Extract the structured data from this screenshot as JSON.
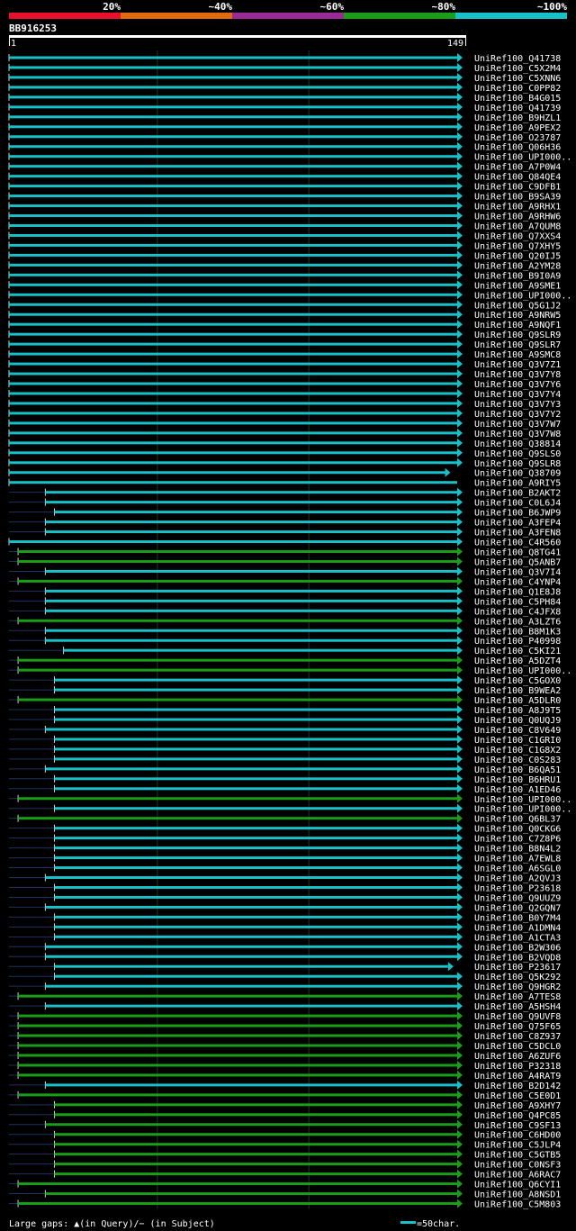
{
  "colors": {
    "background": "#000000",
    "grid": "#1c3a1c",
    "band_red": "#e8102a",
    "band_orange": "#e06a10",
    "band_purple": "#9a2a96",
    "band_green": "#1a9e1a",
    "band_cyan": "#18c0c8",
    "cyan_hit": "#18c0c8",
    "green_hit": "#1a9e1a",
    "gap": "#203060"
  },
  "legend": {
    "labels": [
      "20%",
      "~40%",
      "~60%",
      "~80%",
      "~100%"
    ]
  },
  "query": {
    "name": "BB916253",
    "start_label": "1",
    "end_label": "149"
  },
  "footer": {
    "gaps_text": "Large gaps: ▲(in Query)/− (in Subject)",
    "scale_text": "=50char."
  },
  "chart_data": {
    "type": "alignment",
    "query_length": 149,
    "grid_x": [
      50,
      100
    ],
    "hits": [
      {
        "name": "UniRef100_Q41738",
        "start": 1,
        "end": 149,
        "identity": "~100%",
        "arrow": true
      },
      {
        "name": "UniRef100_C5X2M4",
        "start": 1,
        "end": 149,
        "identity": "~100%",
        "arrow": true
      },
      {
        "name": "UniRef100_C5XNN6",
        "start": 1,
        "end": 149,
        "identity": "~100%",
        "arrow": true
      },
      {
        "name": "UniRef100_C0PP82",
        "start": 1,
        "end": 149,
        "identity": "~100%",
        "arrow": true
      },
      {
        "name": "UniRef100_B4G015",
        "start": 1,
        "end": 149,
        "identity": "~100%",
        "arrow": true
      },
      {
        "name": "UniRef100_Q41739",
        "start": 1,
        "end": 149,
        "identity": "~100%",
        "arrow": true
      },
      {
        "name": "UniRef100_B9HZL1",
        "start": 1,
        "end": 149,
        "identity": "~100%",
        "arrow": true
      },
      {
        "name": "UniRef100_A9PEX2",
        "start": 1,
        "end": 149,
        "identity": "~100%",
        "arrow": true
      },
      {
        "name": "UniRef100_O23787",
        "start": 1,
        "end": 149,
        "identity": "~100%",
        "arrow": true
      },
      {
        "name": "UniRef100_Q06H36",
        "start": 1,
        "end": 149,
        "identity": "~100%",
        "arrow": true
      },
      {
        "name": "UniRef100_UPI000..",
        "start": 1,
        "end": 149,
        "identity": "~100%",
        "arrow": true
      },
      {
        "name": "UniRef100_A7P0W4",
        "start": 1,
        "end": 149,
        "identity": "~100%",
        "arrow": true
      },
      {
        "name": "UniRef100_Q84QE4",
        "start": 1,
        "end": 149,
        "identity": "~100%",
        "arrow": true
      },
      {
        "name": "UniRef100_C9DFB1",
        "start": 1,
        "end": 149,
        "identity": "~100%",
        "arrow": true
      },
      {
        "name": "UniRef100_B9SA39",
        "start": 1,
        "end": 149,
        "identity": "~100%",
        "arrow": true
      },
      {
        "name": "UniRef100_A9RHX1",
        "start": 1,
        "end": 149,
        "identity": "~100%",
        "arrow": true
      },
      {
        "name": "UniRef100_A9RHW6",
        "start": 1,
        "end": 149,
        "identity": "~100%",
        "arrow": true
      },
      {
        "name": "UniRef100_A7QUM8",
        "start": 1,
        "end": 149,
        "identity": "~100%",
        "arrow": true
      },
      {
        "name": "UniRef100_Q7XXS4",
        "start": 1,
        "end": 149,
        "identity": "~100%",
        "arrow": true
      },
      {
        "name": "UniRef100_Q7XHY5",
        "start": 1,
        "end": 149,
        "identity": "~100%",
        "arrow": true
      },
      {
        "name": "UniRef100_Q20IJ5",
        "start": 1,
        "end": 149,
        "identity": "~100%",
        "arrow": true
      },
      {
        "name": "UniRef100_A2YM28",
        "start": 1,
        "end": 149,
        "identity": "~100%",
        "arrow": true
      },
      {
        "name": "UniRef100_B9I0A9",
        "start": 1,
        "end": 149,
        "identity": "~100%",
        "arrow": true
      },
      {
        "name": "UniRef100_A9SME1",
        "start": 1,
        "end": 149,
        "identity": "~100%",
        "arrow": true
      },
      {
        "name": "UniRef100_UPI000..",
        "start": 1,
        "end": 149,
        "identity": "~100%",
        "arrow": true
      },
      {
        "name": "UniRef100_Q5G1J2",
        "start": 1,
        "end": 149,
        "identity": "~100%",
        "arrow": true
      },
      {
        "name": "UniRef100_A9NRW5",
        "start": 1,
        "end": 149,
        "identity": "~100%",
        "arrow": true
      },
      {
        "name": "UniRef100_A9NQF1",
        "start": 1,
        "end": 149,
        "identity": "~100%",
        "arrow": true
      },
      {
        "name": "UniRef100_Q9SLR9",
        "start": 1,
        "end": 149,
        "identity": "~100%",
        "arrow": true
      },
      {
        "name": "UniRef100_Q9SLR7",
        "start": 1,
        "end": 149,
        "identity": "~100%",
        "arrow": true
      },
      {
        "name": "UniRef100_A9SMC8",
        "start": 1,
        "end": 149,
        "identity": "~100%",
        "arrow": true
      },
      {
        "name": "UniRef100_Q3V7Z1",
        "start": 1,
        "end": 149,
        "identity": "~100%",
        "arrow": true
      },
      {
        "name": "UniRef100_Q3V7Y8",
        "start": 1,
        "end": 149,
        "identity": "~100%",
        "arrow": true
      },
      {
        "name": "UniRef100_Q3V7Y6",
        "start": 1,
        "end": 149,
        "identity": "~100%",
        "arrow": true
      },
      {
        "name": "UniRef100_Q3V7Y4",
        "start": 1,
        "end": 149,
        "identity": "~100%",
        "arrow": true
      },
      {
        "name": "UniRef100_Q3V7Y3",
        "start": 1,
        "end": 149,
        "identity": "~100%",
        "arrow": true
      },
      {
        "name": "UniRef100_Q3V7Y2",
        "start": 1,
        "end": 149,
        "identity": "~100%",
        "arrow": true
      },
      {
        "name": "UniRef100_Q3V7W7",
        "start": 1,
        "end": 149,
        "identity": "~100%",
        "arrow": true
      },
      {
        "name": "UniRef100_Q3V7W8",
        "start": 1,
        "end": 149,
        "identity": "~100%",
        "arrow": true
      },
      {
        "name": "UniRef100_Q38814",
        "start": 1,
        "end": 149,
        "identity": "~100%",
        "arrow": true
      },
      {
        "name": "UniRef100_Q9SLS0",
        "start": 1,
        "end": 149,
        "identity": "~100%",
        "arrow": true
      },
      {
        "name": "UniRef100_Q9SLR8",
        "start": 1,
        "end": 149,
        "identity": "~100%",
        "arrow": true
      },
      {
        "name": "UniRef100_Q38709",
        "start": 1,
        "end": 145,
        "identity": "~100%",
        "arrow": true
      },
      {
        "name": "UniRef100_A9RIY5",
        "start": 1,
        "end": 149,
        "identity": "~100%",
        "arrow": false
      },
      {
        "name": "UniRef100_B2AKT2",
        "start": 13,
        "end": 149,
        "identity": "~100%",
        "arrow": true
      },
      {
        "name": "UniRef100_C0L6J4",
        "start": 13,
        "end": 149,
        "identity": "~100%",
        "arrow": true
      },
      {
        "name": "UniRef100_B6JWP9",
        "start": 16,
        "end": 149,
        "identity": "~100%",
        "arrow": true
      },
      {
        "name": "UniRef100_A3FEP4",
        "start": 13,
        "end": 149,
        "identity": "~100%",
        "arrow": true
      },
      {
        "name": "UniRef100_A3FEN8",
        "start": 13,
        "end": 149,
        "identity": "~100%",
        "arrow": true
      },
      {
        "name": "UniRef100_C4R560",
        "start": 1,
        "end": 149,
        "identity": "~100%",
        "arrow": true
      },
      {
        "name": "UniRef100_Q8TG41",
        "start": 4,
        "end": 149,
        "identity": "~80%",
        "arrow": true
      },
      {
        "name": "UniRef100_Q5ANB7",
        "start": 4,
        "end": 149,
        "identity": "~80%",
        "arrow": true
      },
      {
        "name": "UniRef100_Q3V7I4",
        "start": 13,
        "end": 149,
        "identity": "~100%",
        "arrow": true
      },
      {
        "name": "UniRef100_C4YNP4",
        "start": 4,
        "end": 149,
        "identity": "~80%",
        "arrow": true
      },
      {
        "name": "UniRef100_Q1E8J8",
        "start": 13,
        "end": 149,
        "identity": "~100%",
        "arrow": true
      },
      {
        "name": "UniRef100_C5PH84",
        "start": 13,
        "end": 149,
        "identity": "~100%",
        "arrow": true
      },
      {
        "name": "UniRef100_C4JFX8",
        "start": 13,
        "end": 149,
        "identity": "~100%",
        "arrow": true
      },
      {
        "name": "UniRef100_A3LZT6",
        "start": 4,
        "end": 149,
        "identity": "~80%",
        "arrow": true
      },
      {
        "name": "UniRef100_B8M1K3",
        "start": 13,
        "end": 149,
        "identity": "~100%",
        "arrow": true
      },
      {
        "name": "UniRef100_P40998",
        "start": 13,
        "end": 149,
        "identity": "~100%",
        "arrow": true
      },
      {
        "name": "UniRef100_C5KI21",
        "start": 19,
        "end": 149,
        "identity": "~100%",
        "arrow": true
      },
      {
        "name": "UniRef100_A5DZT4",
        "start": 4,
        "end": 149,
        "identity": "~80%",
        "arrow": true
      },
      {
        "name": "UniRef100_UPI000..",
        "start": 4,
        "end": 149,
        "identity": "~80%",
        "arrow": true
      },
      {
        "name": "UniRef100_C5GOX0",
        "start": 16,
        "end": 149,
        "identity": "~100%",
        "arrow": true
      },
      {
        "name": "UniRef100_B9WEA2",
        "start": 16,
        "end": 149,
        "identity": "~100%",
        "arrow": true
      },
      {
        "name": "UniRef100_A5DLR0",
        "start": 4,
        "end": 149,
        "identity": "~80%",
        "arrow": true
      },
      {
        "name": "UniRef100_A8J9T5",
        "start": 16,
        "end": 149,
        "identity": "~100%",
        "arrow": true
      },
      {
        "name": "UniRef100_Q0UQJ9",
        "start": 16,
        "end": 149,
        "identity": "~100%",
        "arrow": true
      },
      {
        "name": "UniRef100_C8V649",
        "start": 13,
        "end": 149,
        "identity": "~100%",
        "arrow": true
      },
      {
        "name": "UniRef100_C1GRI0",
        "start": 16,
        "end": 149,
        "identity": "~100%",
        "arrow": true
      },
      {
        "name": "UniRef100_C1G8X2",
        "start": 16,
        "end": 149,
        "identity": "~100%",
        "arrow": true
      },
      {
        "name": "UniRef100_C0S283",
        "start": 16,
        "end": 149,
        "identity": "~100%",
        "arrow": true
      },
      {
        "name": "UniRef100_B6QA51",
        "start": 13,
        "end": 149,
        "identity": "~100%",
        "arrow": true
      },
      {
        "name": "UniRef100_B6HRU1",
        "start": 16,
        "end": 149,
        "identity": "~100%",
        "arrow": true
      },
      {
        "name": "UniRef100_A1ED46",
        "start": 16,
        "end": 149,
        "identity": "~100%",
        "arrow": true
      },
      {
        "name": "UniRef100_UPI000..",
        "start": 4,
        "end": 149,
        "identity": "~80%",
        "arrow": true
      },
      {
        "name": "UniRef100_UPI000..",
        "start": 16,
        "end": 149,
        "identity": "~100%",
        "arrow": true
      },
      {
        "name": "UniRef100_Q6BL37",
        "start": 4,
        "end": 149,
        "identity": "~80%",
        "arrow": true
      },
      {
        "name": "UniRef100_Q0CKG6",
        "start": 16,
        "end": 149,
        "identity": "~100%",
        "arrow": true
      },
      {
        "name": "UniRef100_C7Z8P6",
        "start": 16,
        "end": 149,
        "identity": "~100%",
        "arrow": true
      },
      {
        "name": "UniRef100_B8N4L2",
        "start": 16,
        "end": 149,
        "identity": "~100%",
        "arrow": true
      },
      {
        "name": "UniRef100_A7EWL8",
        "start": 16,
        "end": 149,
        "identity": "~100%",
        "arrow": true
      },
      {
        "name": "UniRef100_A6SGL0",
        "start": 16,
        "end": 149,
        "identity": "~100%",
        "arrow": true
      },
      {
        "name": "UniRef100_A2QVJ3",
        "start": 13,
        "end": 149,
        "identity": "~100%",
        "arrow": true
      },
      {
        "name": "UniRef100_P23618",
        "start": 16,
        "end": 149,
        "identity": "~100%",
        "arrow": true
      },
      {
        "name": "UniRef100_Q9UUZ9",
        "start": 16,
        "end": 149,
        "identity": "~100%",
        "arrow": true
      },
      {
        "name": "UniRef100_Q2GQN7",
        "start": 13,
        "end": 149,
        "identity": "~100%",
        "arrow": true
      },
      {
        "name": "UniRef100_B0Y7M4",
        "start": 16,
        "end": 149,
        "identity": "~100%",
        "arrow": true
      },
      {
        "name": "UniRef100_A1DMN4",
        "start": 16,
        "end": 149,
        "identity": "~100%",
        "arrow": true
      },
      {
        "name": "UniRef100_A1CTA3",
        "start": 16,
        "end": 149,
        "identity": "~100%",
        "arrow": true
      },
      {
        "name": "UniRef100_B2W306",
        "start": 13,
        "end": 149,
        "identity": "~100%",
        "arrow": true
      },
      {
        "name": "UniRef100_B2VQD8",
        "start": 13,
        "end": 149,
        "identity": "~100%",
        "arrow": true
      },
      {
        "name": "UniRef100_P23617",
        "start": 16,
        "end": 146,
        "identity": "~100%",
        "arrow": true
      },
      {
        "name": "UniRef100_Q5K292",
        "start": 16,
        "end": 149,
        "identity": "~100%",
        "arrow": true
      },
      {
        "name": "UniRef100_Q9HGR2",
        "start": 13,
        "end": 149,
        "identity": "~100%",
        "arrow": true
      },
      {
        "name": "UniRef100_A7TES8",
        "start": 4,
        "end": 149,
        "identity": "~80%",
        "arrow": true
      },
      {
        "name": "UniRef100_A5HSH4",
        "start": 13,
        "end": 149,
        "identity": "~100%",
        "arrow": true
      },
      {
        "name": "UniRef100_Q9UVF8",
        "start": 4,
        "end": 149,
        "identity": "~80%",
        "arrow": true
      },
      {
        "name": "UniRef100_Q75F65",
        "start": 4,
        "end": 149,
        "identity": "~80%",
        "arrow": true
      },
      {
        "name": "UniRef100_C8Z937",
        "start": 4,
        "end": 149,
        "identity": "~80%",
        "arrow": true
      },
      {
        "name": "UniRef100_C5DCL0",
        "start": 4,
        "end": 149,
        "identity": "~80%",
        "arrow": true
      },
      {
        "name": "UniRef100_A6ZUF6",
        "start": 4,
        "end": 149,
        "identity": "~80%",
        "arrow": true
      },
      {
        "name": "UniRef100_P32318",
        "start": 4,
        "end": 149,
        "identity": "~80%",
        "arrow": true
      },
      {
        "name": "UniRef100_A4RAT9",
        "start": 4,
        "end": 149,
        "identity": "~80%",
        "arrow": true
      },
      {
        "name": "UniRef100_B2D142",
        "start": 13,
        "end": 149,
        "identity": "~100%",
        "arrow": true
      },
      {
        "name": "UniRef100_C5E0D1",
        "start": 4,
        "end": 149,
        "identity": "~80%",
        "arrow": true
      },
      {
        "name": "UniRef100_A9XHY7",
        "start": 16,
        "end": 149,
        "identity": "~80%",
        "arrow": true
      },
      {
        "name": "UniRef100_Q4PC85",
        "start": 16,
        "end": 149,
        "identity": "~80%",
        "arrow": true
      },
      {
        "name": "UniRef100_C9SF13",
        "start": 13,
        "end": 149,
        "identity": "~80%",
        "arrow": true
      },
      {
        "name": "UniRef100_C6HD00",
        "start": 16,
        "end": 149,
        "identity": "~80%",
        "arrow": true
      },
      {
        "name": "UniRef100_C5JLP4",
        "start": 16,
        "end": 149,
        "identity": "~80%",
        "arrow": true
      },
      {
        "name": "UniRef100_C5GTB5",
        "start": 16,
        "end": 149,
        "identity": "~80%",
        "arrow": true
      },
      {
        "name": "UniRef100_C0NSF3",
        "start": 16,
        "end": 149,
        "identity": "~80%",
        "arrow": true
      },
      {
        "name": "UniRef100_A6RAC7",
        "start": 16,
        "end": 149,
        "identity": "~80%",
        "arrow": true
      },
      {
        "name": "UniRef100_Q6CYI1",
        "start": 4,
        "end": 149,
        "identity": "~80%",
        "arrow": true
      },
      {
        "name": "UniRef100_A8NSD1",
        "start": 13,
        "end": 149,
        "identity": "~80%",
        "arrow": true
      },
      {
        "name": "UniRef100_C5M803",
        "start": 4,
        "end": 149,
        "identity": "~80%",
        "arrow": true
      }
    ]
  }
}
